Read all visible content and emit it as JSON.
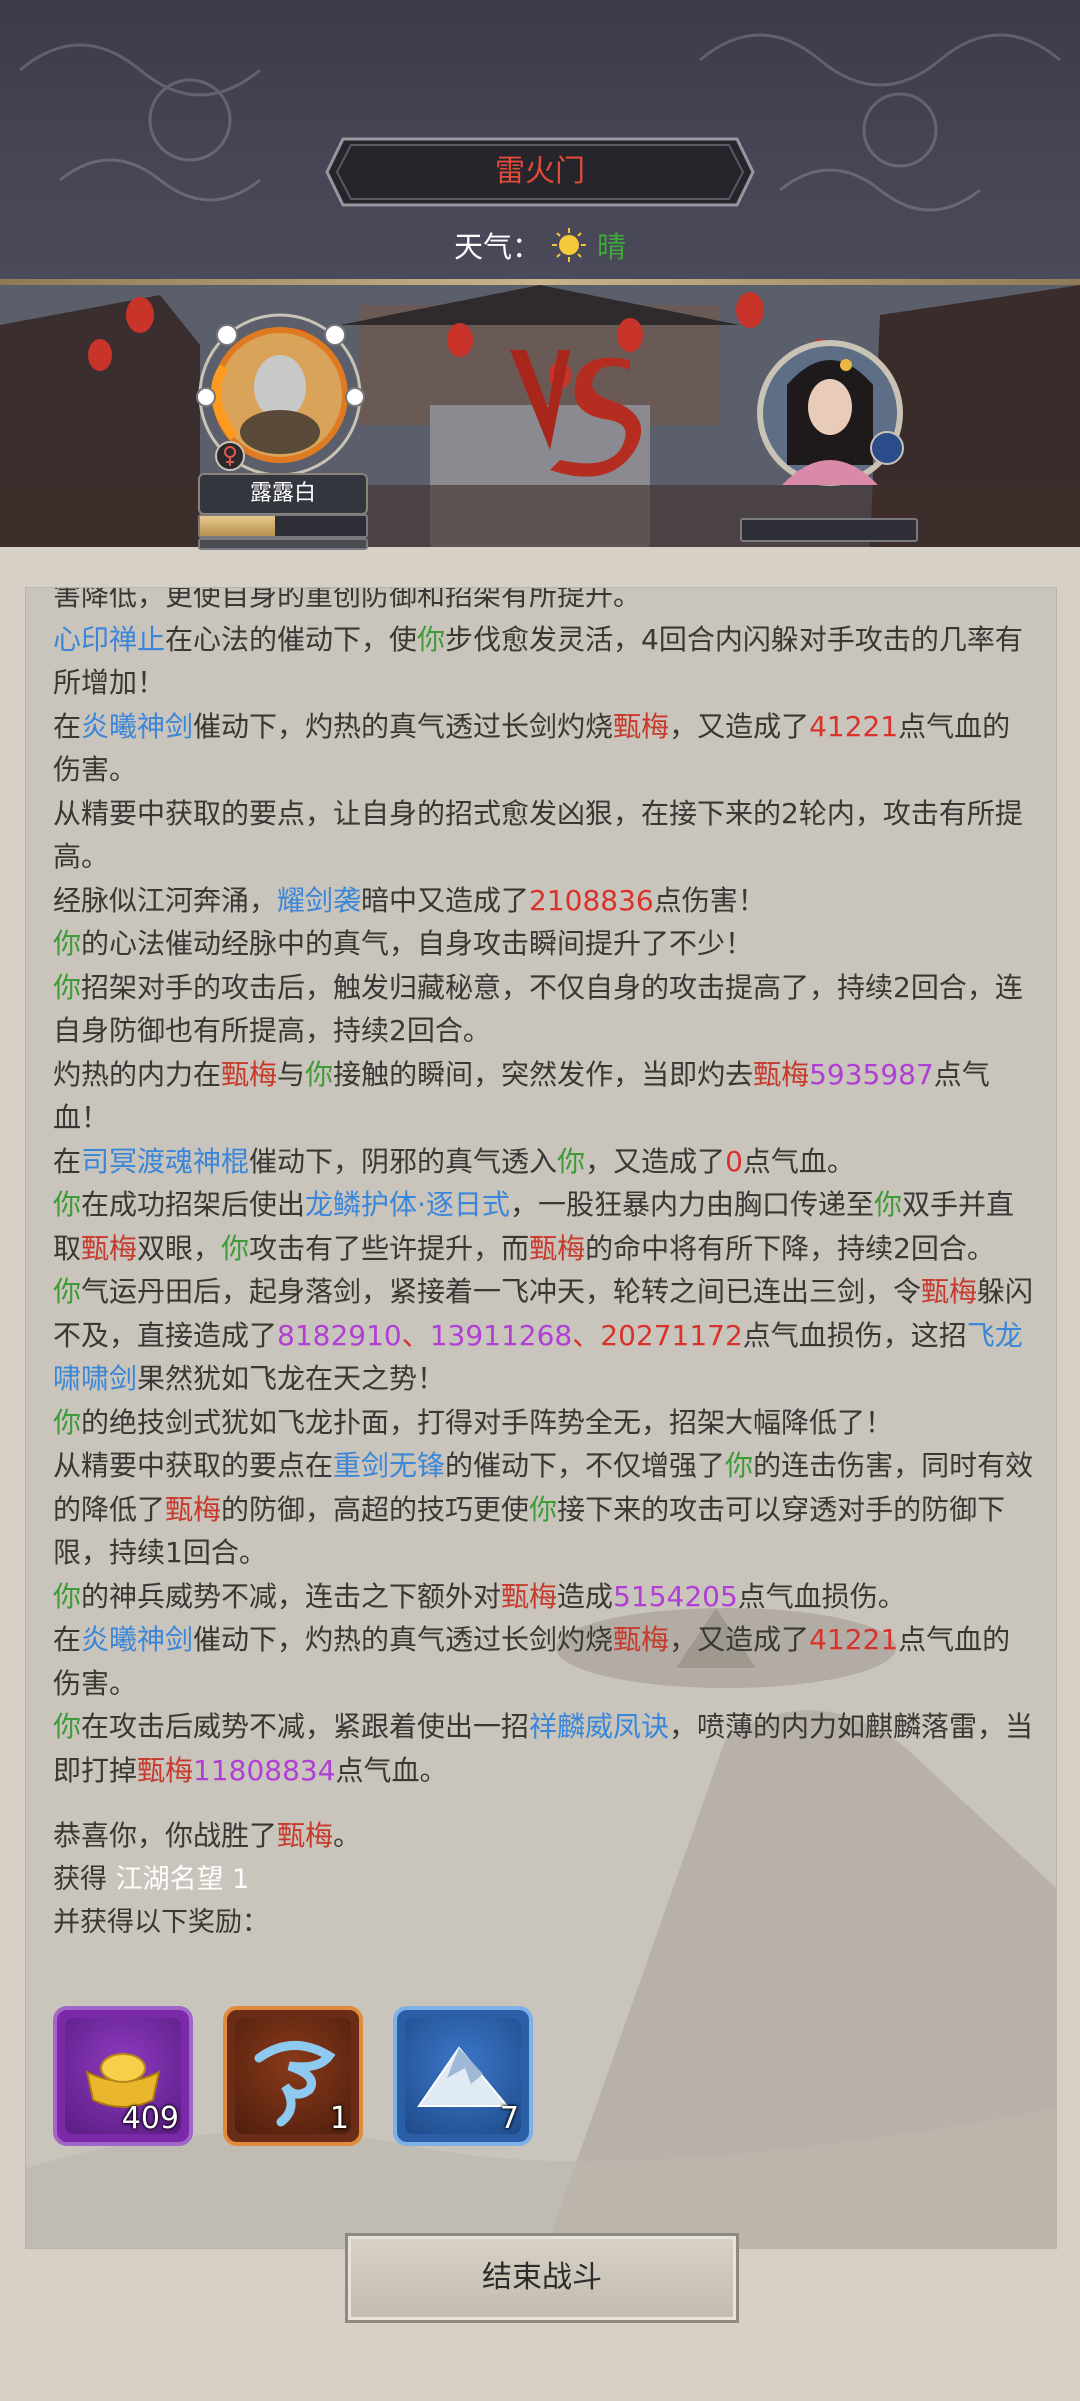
{
  "header": {
    "title": "雷火门",
    "weather_label": "天气：",
    "weather_value": "晴",
    "weather_icon": "sun-icon"
  },
  "battle": {
    "player_name": "露露白",
    "player_gender_icon": "female-icon",
    "player_hp_fraction": 0.45,
    "enemy_hp_fraction": 0.0,
    "vs_icon": "vs-emblem-icon"
  },
  "log": {
    "l0": "害降低，更使自身的重创防御和招架有所提升。",
    "l1_skill": "心印禅止",
    "l1_a": "在心法的催动下，使",
    "l1_you": "你",
    "l1_b": "步伐愈发灵活，4回合内闪躲对手攻击的几率有所增加！",
    "l2_a": "在",
    "l2_skill": "炎曦神剑",
    "l2_b": "催动下，灼热的真气透过长剑灼烧",
    "l2_enemy": "甄梅",
    "l2_c": "，又造成了",
    "l2_num": "41221",
    "l2_d": "点气血的伤害。",
    "l3": "从精要中获取的要点，让自身的招式愈发凶狠，在接下来的2轮内，攻击有所提高。",
    "l4_a": "经脉似江河奔涌，",
    "l4_skill": "耀剑袭",
    "l4_b": "暗中又造成了",
    "l4_num": "2108836",
    "l4_c": "点伤害！",
    "l5_you": "你",
    "l5_a": "的心法催动经脉中的真气，自身攻击瞬间提升了不少！",
    "l6_you": "你",
    "l6_a": "招架对手的攻击后，触发归藏秘意，不仅自身的攻击提高了，持续2回合，连自身防御也有所提高，持续2回合。",
    "l7_a": "灼热的内力在",
    "l7_enemy": "甄梅",
    "l7_b": "与",
    "l7_you": "你",
    "l7_c": "接触的瞬间，突然发作，当即灼去",
    "l7_enemy2": "甄梅",
    "l7_num": "5935987",
    "l7_d": "点气血！",
    "l8_a": "在",
    "l8_skill": "司冥渡魂神棍",
    "l8_b": "催动下，阴邪的真气透入",
    "l8_you": "你",
    "l8_c": "，又造成了",
    "l8_num": "0",
    "l8_d": "点气血。",
    "l9_you": "你",
    "l9_a": "在成功招架后使出",
    "l9_skill": "龙鳞护体·逐日式",
    "l9_b": "，一股狂暴内力由胸口传递至",
    "l9_you2": "你",
    "l9_c": "双手并直取",
    "l9_enemy": "甄梅",
    "l9_d": "双眼，",
    "l9_you3": "你",
    "l9_e": "攻击有了些许提升，而",
    "l9_enemy2": "甄梅",
    "l9_f": "的命中将有所下降，持续2回合。",
    "l10_you": "你",
    "l10_a": "气运丹田后，起身落剑，紧接着一飞冲天，轮转之间已连出三剑，令",
    "l10_enemy": "甄梅",
    "l10_b": "躲闪不及，直接造成了",
    "l10_n1": "8182910",
    "l10_sep1": "、",
    "l10_n2": "13911268",
    "l10_sep2": "、",
    "l10_n3": "20271172",
    "l10_c": "点气血损伤，这招",
    "l10_skill": "飞龙啸啸剑",
    "l10_d": "果然犹如飞龙在天之势！",
    "l11_you": "你",
    "l11_a": "的绝技剑式犹如飞龙扑面，打得对手阵势全无，招架大幅降低了！",
    "l12_a": "从精要中获取的要点在",
    "l12_skill": "重剑无锋",
    "l12_b": "的催动下，不仅增强了",
    "l12_you": "你",
    "l12_c": "的连击伤害，同时有效的降低了",
    "l12_enemy": "甄梅",
    "l12_d": "的防御，高超的技巧更使",
    "l12_you2": "你",
    "l12_e": "接下来的攻击可以穿透对手的防御下限，持续1回合。",
    "l13_you": "你",
    "l13_a": "的神兵威势不减，连击之下额外对",
    "l13_enemy": "甄梅",
    "l13_b": "造成",
    "l13_num": "5154205",
    "l13_c": "点气血损伤。",
    "l14_a": "在",
    "l14_skill": "炎曦神剑",
    "l14_b": "催动下，灼热的真气透过长剑灼烧",
    "l14_enemy": "甄梅",
    "l14_c": "，又造成了",
    "l14_num": "41221",
    "l14_d": "点气血的伤害。",
    "l15_you": "你",
    "l15_a": "在攻击后威势不减，紧跟着使出一招",
    "l15_skill": "祥麟威凤诀",
    "l15_b": "，喷薄的内力如麒麟落雷，当即打掉",
    "l15_enemy": "甄梅",
    "l15_num": "11808834",
    "l15_c": "点气血。",
    "victory_a": "恭喜你，你战胜了",
    "victory_enemy": "甄梅",
    "victory_b": "。",
    "gain_label": "获得",
    "gain_fame": "江湖名望 1",
    "reward_label": "并获得以下奖励："
  },
  "rewards": [
    {
      "icon": "gold-ingot-icon",
      "count": "409"
    },
    {
      "icon": "blue-whirlwind-icon",
      "count": "1"
    },
    {
      "icon": "snow-mountain-icon",
      "count": "7"
    }
  ],
  "footer": {
    "end_button": "结束战斗"
  },
  "colors": {
    "you": "#3f9a38",
    "enemy": "#c63a2c",
    "skill": "#3a86d8",
    "damage_red": "#d9322a",
    "damage_purple": "#b13fd6"
  }
}
